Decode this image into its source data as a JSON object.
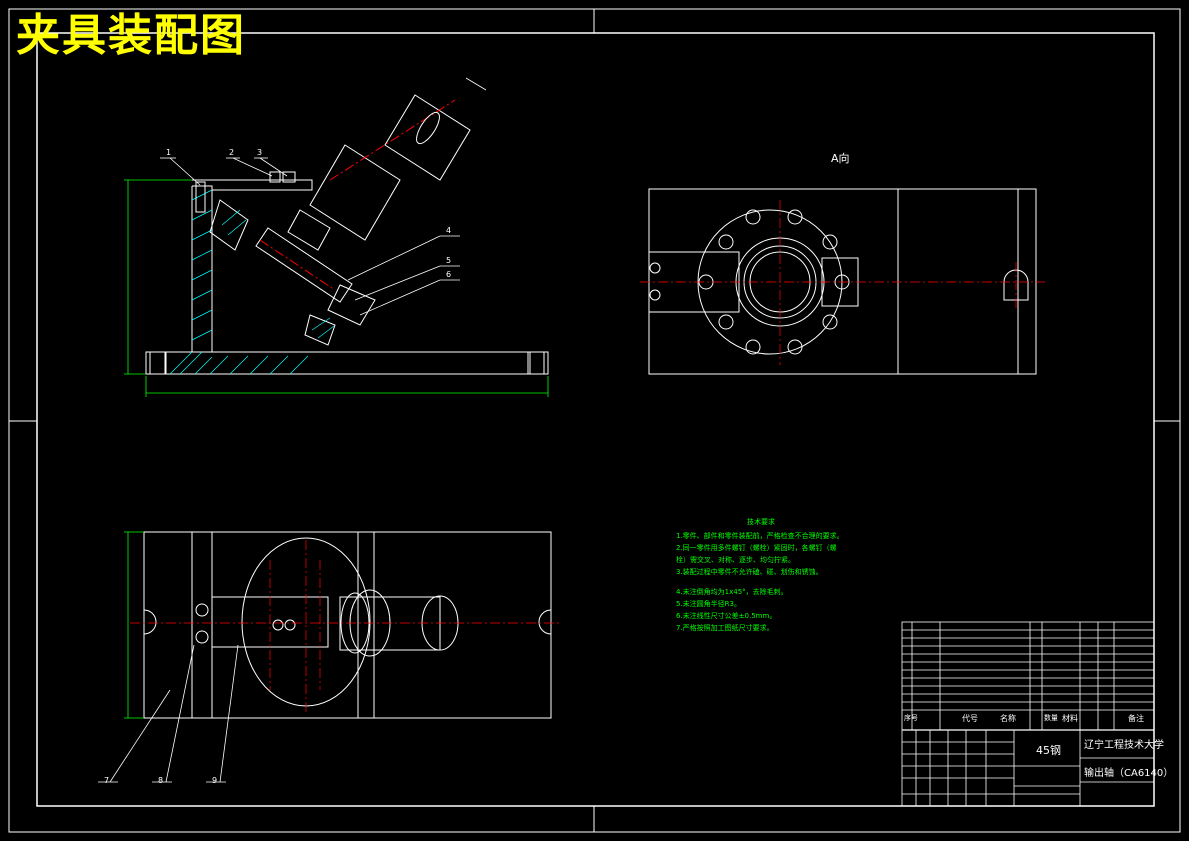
{
  "title": "夹具装配图",
  "view_label": "A向",
  "callouts": [
    "1",
    "2",
    "3",
    "4",
    "5",
    "6",
    "7",
    "8",
    "9"
  ],
  "technical_notes": {
    "heading": "技术要求",
    "lines": [
      "1.零件、部件和零件装配前，严格检查不合理的要求。",
      "2.同一零件用多件螺钉（螺栓）紧固时，各螺钉（螺栓）需交叉、对称、逐步、均匀拧紧。",
      "3.装配过程中零件不允许磕、碰、划伤和锈蚀。",
      "4.未注倒角均为1x45°，去除毛刺。",
      "5.未注圆角半径R3。",
      "6.未注线性尺寸公差±0.5mm。",
      "7.严格按照加工图纸尺寸要求。"
    ]
  },
  "title_block": {
    "material": "45钢",
    "school": "辽宁工程技术大学",
    "drawing_name": "输出轴（CA6140）",
    "headers": {
      "no": "序号",
      "code": "代号",
      "name": "名称",
      "qty": "数量",
      "material": "材料",
      "note": "备注"
    }
  },
  "colors": {
    "title": "#ffff00",
    "notes": "#00ff00",
    "dimension": "#00ff00",
    "centerline": "#ff0000",
    "hatch": "#00ffff",
    "line": "#ffffff"
  }
}
